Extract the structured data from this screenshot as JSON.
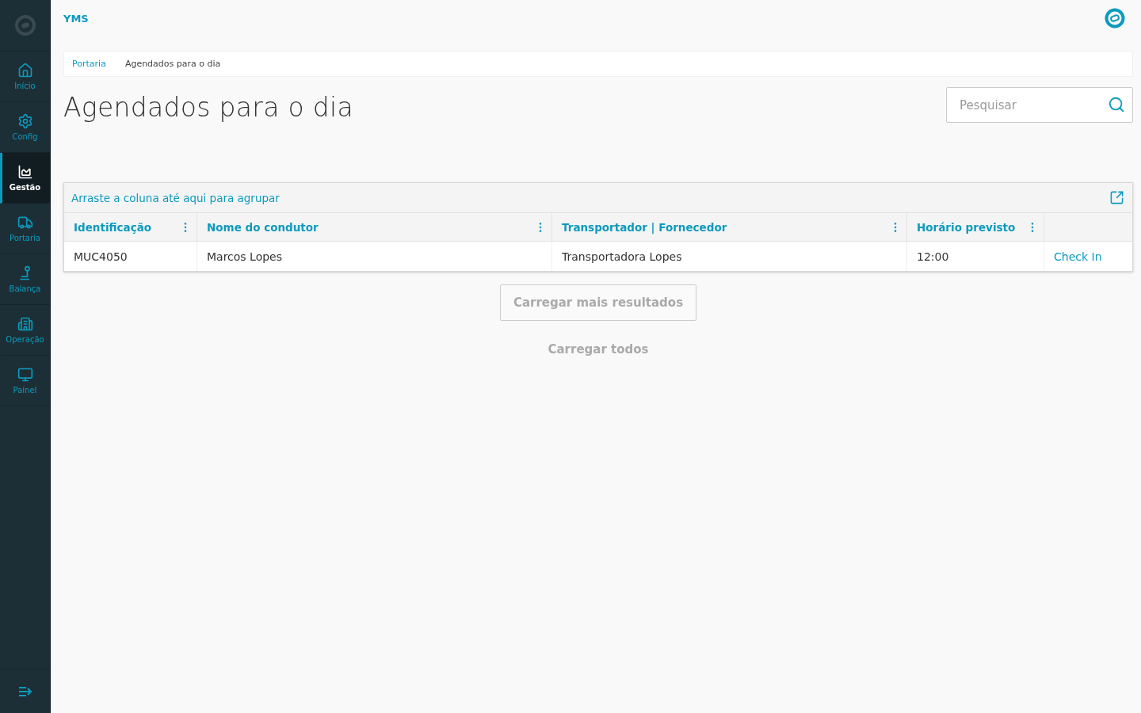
{
  "sidebar": {
    "items": [
      {
        "label": "Início",
        "kind": "home",
        "selected": false
      },
      {
        "label": "Config",
        "kind": "settings",
        "selected": false
      },
      {
        "label": "Gestão",
        "kind": "chart",
        "selected": true
      },
      {
        "label": "Portaria",
        "kind": "truck",
        "selected": false
      },
      {
        "label": "Balança",
        "kind": "scale",
        "selected": false
      },
      {
        "label": "Operação",
        "kind": "building",
        "selected": false
      },
      {
        "label": "Painel",
        "kind": "monitor",
        "selected": false
      }
    ]
  },
  "header": {
    "app_name": "YMS"
  },
  "breadcrumb": [
    "Portaria",
    "Agendados para o dia"
  ],
  "page_title": "Agendados para o dia",
  "search": {
    "placeholder": "Pesquisar"
  },
  "grid": {
    "group_hint": "Arraste a coluna até aqui para agrupar",
    "columns": [
      {
        "label": "Identificação",
        "menu": true
      },
      {
        "label": "Nome do condutor",
        "menu": true
      },
      {
        "label": "Transportador | Fornecedor",
        "menu": true
      },
      {
        "label": "Horário previsto",
        "menu": true
      },
      {
        "menu": false
      }
    ],
    "rows": [
      {
        "cells": [
          "MUC4050",
          "Marcos Lopes",
          "Transportadora Lopes",
          "12:00"
        ],
        "action": "Check In"
      }
    ]
  },
  "load_more": "Carregar mais resultados",
  "load_all": "Carregar todos"
}
